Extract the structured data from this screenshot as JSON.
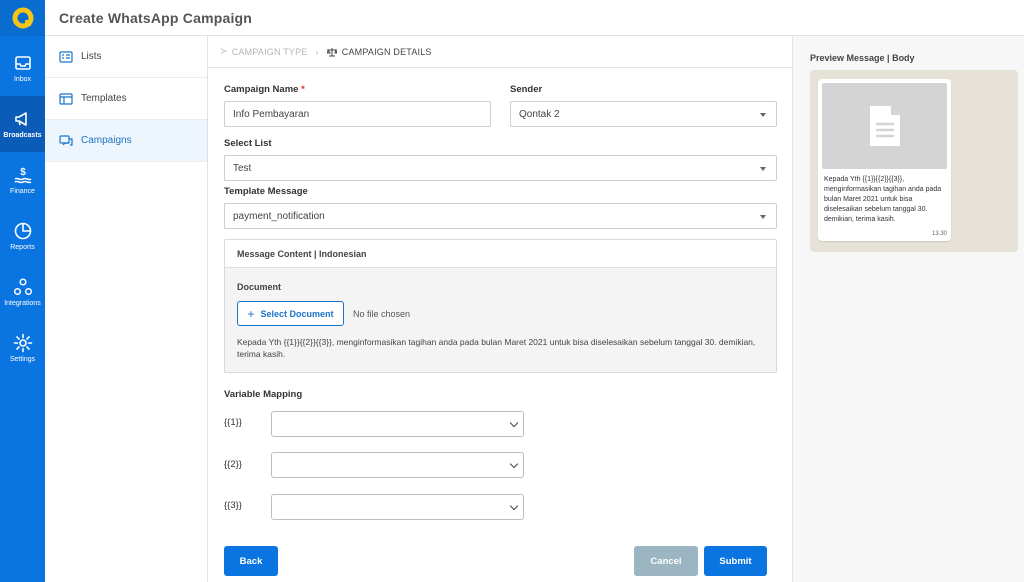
{
  "header": {
    "title": "Create WhatsApp Campaign"
  },
  "rail": {
    "items": [
      {
        "label": "Inbox",
        "icon": "inbox-icon"
      },
      {
        "label": "Broadcasts",
        "icon": "megaphone-icon"
      },
      {
        "label": "Finance",
        "icon": "finance-icon"
      },
      {
        "label": "Reports",
        "icon": "reports-icon"
      },
      {
        "label": "Integrations",
        "icon": "integrations-icon"
      },
      {
        "label": "Settings",
        "icon": "gear-icon"
      }
    ],
    "active": "Broadcasts"
  },
  "submenu": {
    "items": [
      {
        "label": "Lists",
        "icon": "list-icon"
      },
      {
        "label": "Templates",
        "icon": "template-icon"
      },
      {
        "label": "Campaigns",
        "icon": "chat-icon"
      }
    ],
    "active": "Campaigns"
  },
  "breadcrumb": {
    "step1": "CAMPAIGN TYPE",
    "step2": "CAMPAIGN DETAILS"
  },
  "form": {
    "campaign_name_label": "Campaign Name",
    "required_mark": "*",
    "campaign_name_value": "Info Pembayaran",
    "sender_label": "Sender",
    "sender_value": "Qontak 2",
    "select_list_label": "Select List",
    "select_list_value": "Test",
    "template_label": "Template Message",
    "template_value": "payment_notification"
  },
  "message_content": {
    "title": "Message Content | Indonesian",
    "document_label": "Document",
    "select_document_label": "Select Document",
    "no_file": "No file chosen",
    "body": "Kepada Yth {{1}}{{2}}{{3}}, menginformasikan tagihan anda pada bulan Maret 2021 untuk bisa diselesaikan sebelum tanggal 30. demikian, terima kasih."
  },
  "variable_mapping": {
    "title": "Variable Mapping",
    "vars": [
      "{{1}}",
      "{{2}}",
      "{{3}}"
    ]
  },
  "actions": {
    "back": "Back",
    "cancel": "Cancel",
    "submit": "Submit"
  },
  "preview": {
    "title": "Preview Message | Body",
    "body": "Kepada Yth {{1}}{{2}}{{3}}, menginformasikan tagihan anda pada bulan Maret 2021 untuk bisa diselesaikan sebelum tanggal 30. demikian, terima kasih.",
    "time": "13.30"
  },
  "colors": {
    "primary": "#0a75e0",
    "cancel": "#9bb6c2",
    "active_bg": "#eef6fd"
  }
}
